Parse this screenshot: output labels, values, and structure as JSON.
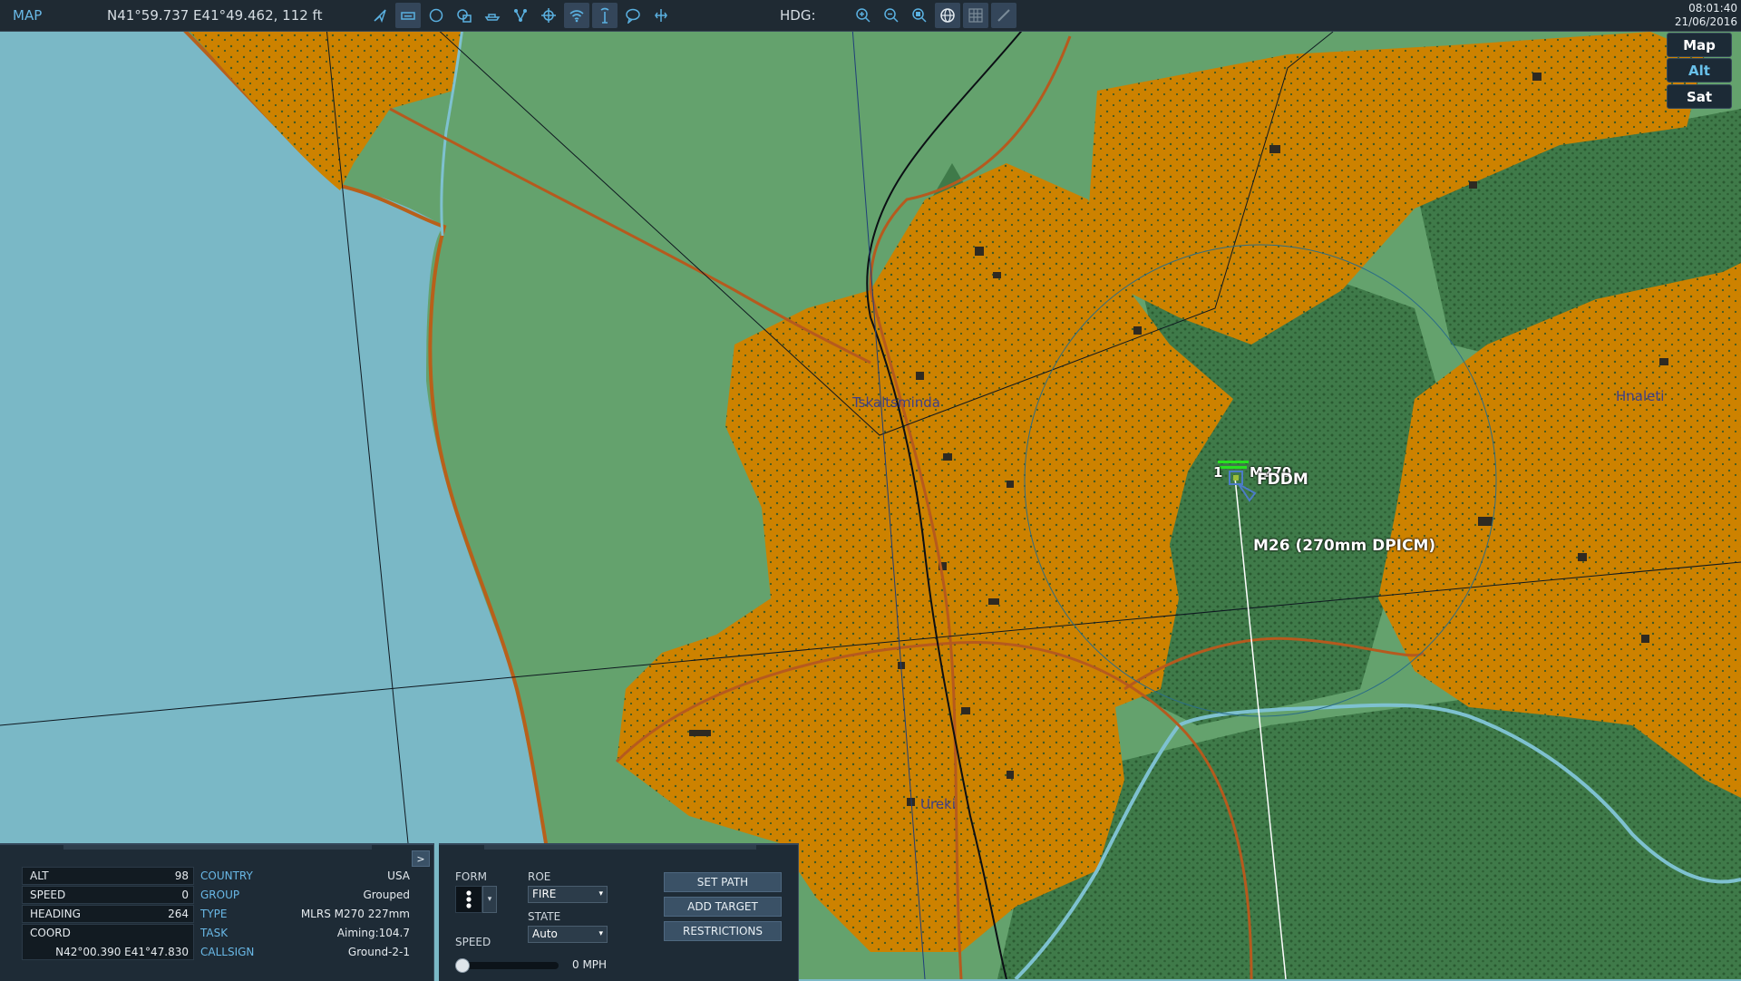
{
  "topbar": {
    "mode": "MAP",
    "cursor_coord": "N41°59.737 E41°49.462, 112 ft",
    "heading_label": "HDG:",
    "time": "08:01:40",
    "date": "21/06/2016",
    "tool_icons": [
      "route-icon",
      "keyboard-icon",
      "circle-icon",
      "multi-window-icon",
      "vehicle-icon",
      "network-icon",
      "crosshair-icon",
      "wifi-icon",
      "antenna-icon",
      "chat-icon",
      "waypoint-icon"
    ],
    "view_icons": [
      "zoom-in-icon",
      "zoom-out-icon",
      "zoom-fit-icon",
      "globe-icon",
      "grid-icon",
      "ruler-icon"
    ]
  },
  "map_types": {
    "map": "Map",
    "alt": "Alt",
    "sat": "Sat",
    "selected": "Alt"
  },
  "map_labels": {
    "town1": "Tskaltsminda",
    "town2": "Hnaleti",
    "town3": "Ureki",
    "unit_count": "1",
    "unit_name": "M270",
    "unit_callsign": "FDDM",
    "weapon": "M26 (270mm DPICM)"
  },
  "info": {
    "expand": ">",
    "alt_label": "ALT",
    "alt": "98",
    "speed_label": "SPEED",
    "speed": "0",
    "heading_label": "HEADING",
    "heading": "264",
    "coord_label": "COORD",
    "coord": "N42°00.390 E41°47.830",
    "country_label": "COUNTRY",
    "country": "USA",
    "group_label": "GROUP",
    "group": "Grouped",
    "type_label": "TYPE",
    "type": "MLRS M270 227mm",
    "task_label": "TASK",
    "task": "Aiming:104.7",
    "callsign_label": "CALLSIGN",
    "callsign": "Ground-2-1"
  },
  "controls": {
    "form_label": "FORM",
    "roe_label": "ROE",
    "roe_value": "FIRE",
    "state_label": "STATE",
    "state_value": "Auto",
    "speed_label": "SPEED",
    "speed_value": "0 MPH",
    "speed_fraction": 0,
    "set_path": "SET PATH",
    "add_target": "ADD TARGET",
    "restrictions": "RESTRICTIONS"
  },
  "colors": {
    "urban": "#cd8200",
    "grass": "#64a26d",
    "forest": "#3f7a49",
    "sea": "#7ab8c6",
    "accent": "#69c1ea",
    "unit_hp": "#27e01f"
  }
}
